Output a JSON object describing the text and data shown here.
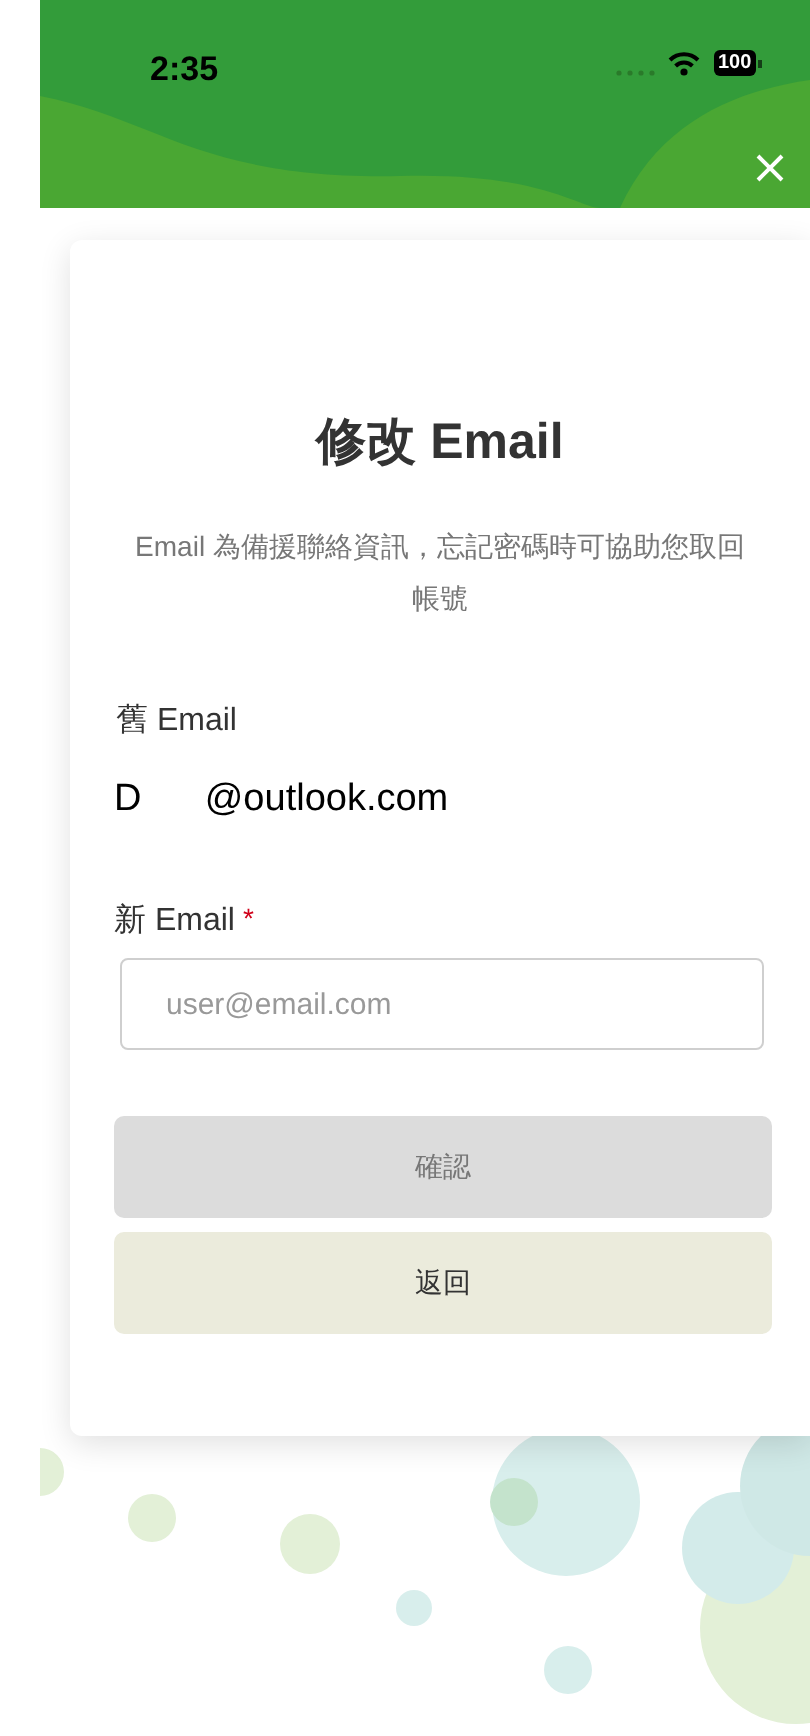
{
  "status_bar": {
    "time": "2:35",
    "battery": "100"
  },
  "dialog": {
    "title": "修改 Email",
    "description": "Email 為備援聯絡資訊，忘記密碼時可協助您取回帳號",
    "old_email": {
      "label": "舊 Email",
      "value": "D      @outlook.com"
    },
    "new_email": {
      "label": "新 Email",
      "required": true,
      "required_mark": "*",
      "placeholder": "user@email.com"
    },
    "buttons": [
      {
        "label": "確認",
        "kind": "primary",
        "disabled": true
      },
      {
        "label": "返回",
        "kind": "secondary",
        "disabled": false
      }
    ]
  }
}
